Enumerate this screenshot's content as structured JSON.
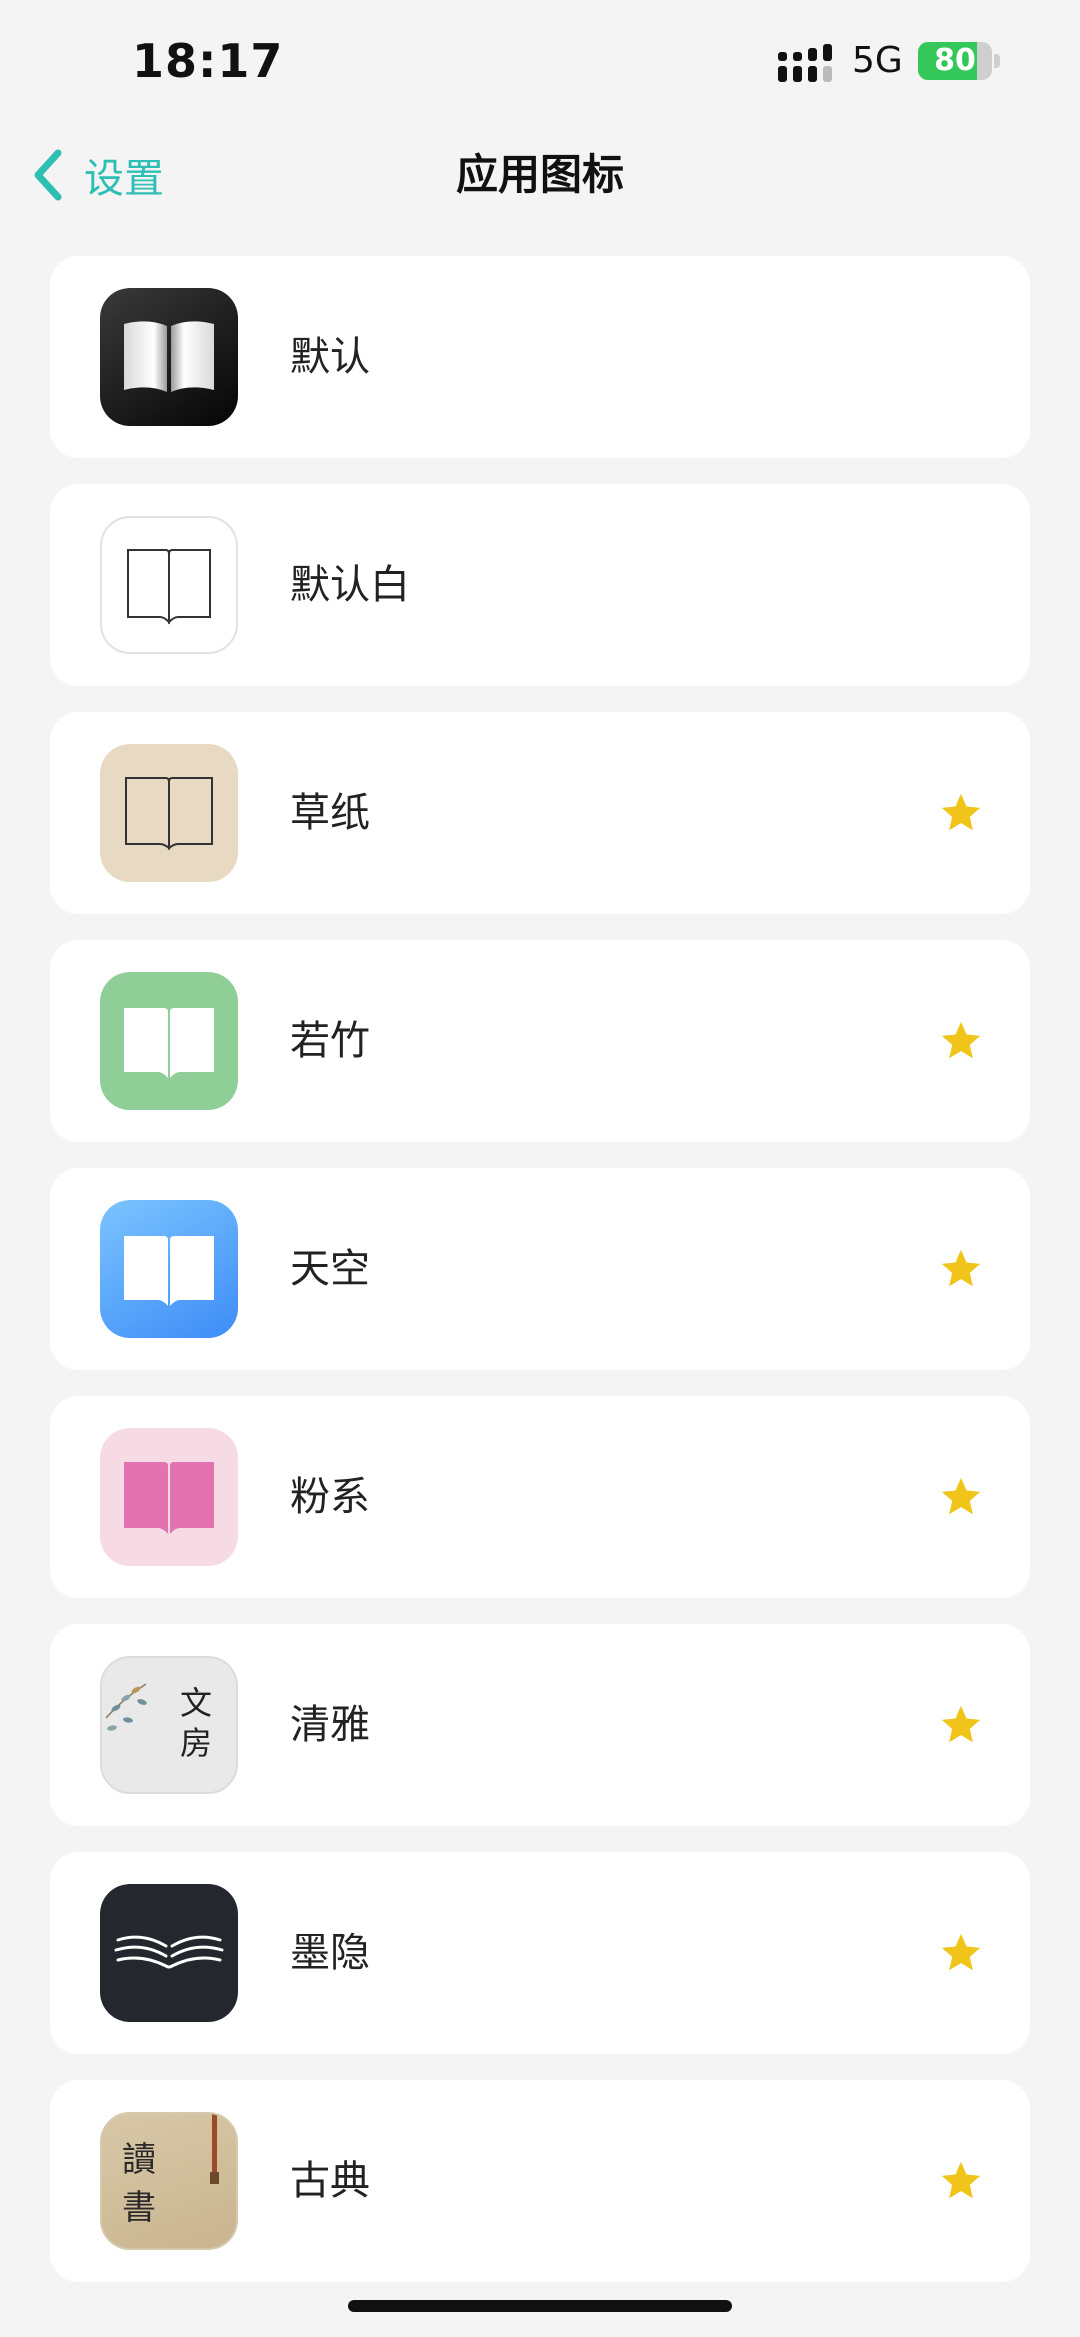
{
  "status_bar": {
    "time": "18:17",
    "network": "5G",
    "battery": "80",
    "battery_level": 0.8
  },
  "nav": {
    "back_label": "设置",
    "title": "应用图标"
  },
  "colors": {
    "accent": "#2dbfb3",
    "star": "#f0c419",
    "battery_green": "#34c759"
  },
  "icons": [
    {
      "label": "默认",
      "icon": "book-black-icon",
      "premium": false
    },
    {
      "label": "默认白",
      "icon": "book-outline-white-icon",
      "premium": false
    },
    {
      "label": "草纸",
      "icon": "book-outline-beige-icon",
      "premium": true
    },
    {
      "label": "若竹",
      "icon": "book-green-icon",
      "premium": true
    },
    {
      "label": "天空",
      "icon": "book-blue-icon",
      "premium": true
    },
    {
      "label": "粉系",
      "icon": "book-pink-icon",
      "premium": true
    },
    {
      "label": "清雅",
      "icon": "wenfang-icon",
      "premium": true,
      "icon_text": [
        "文",
        "房"
      ]
    },
    {
      "label": "墨隐",
      "icon": "book-ink-icon",
      "premium": true
    },
    {
      "label": "古典",
      "icon": "dushu-icon",
      "premium": true,
      "icon_text": [
        "讀",
        "書"
      ]
    }
  ]
}
